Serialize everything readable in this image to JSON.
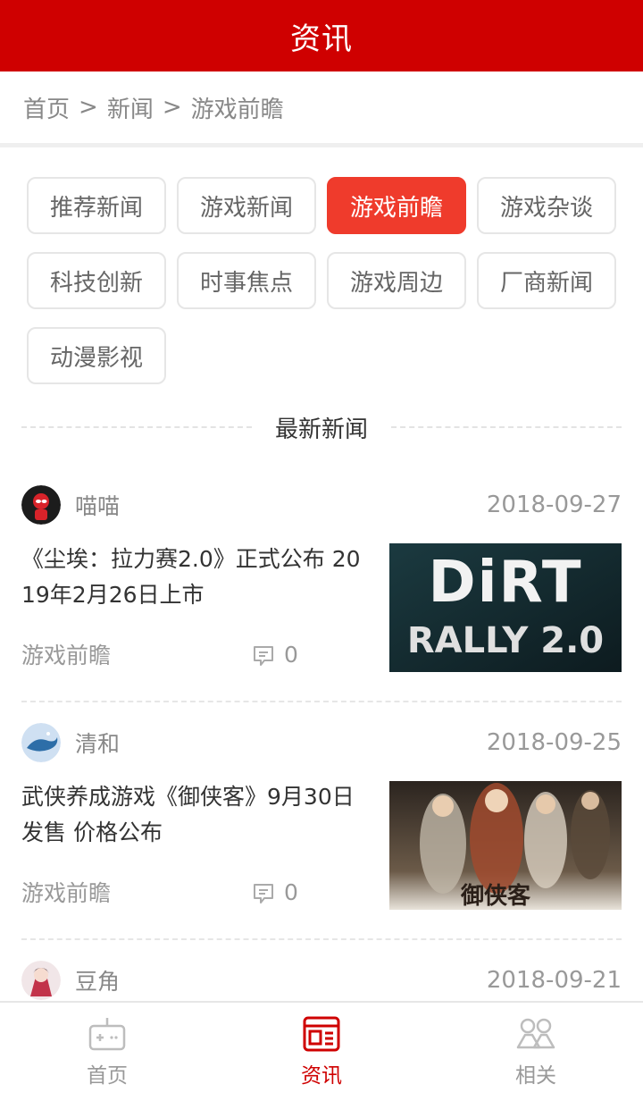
{
  "header": {
    "title": "资讯"
  },
  "breadcrumb": {
    "items": [
      "首页",
      "新闻",
      "游戏前瞻"
    ],
    "separator": ">"
  },
  "categories": [
    {
      "label": "推荐新闻",
      "active": false
    },
    {
      "label": "游戏新闻",
      "active": false
    },
    {
      "label": "游戏前瞻",
      "active": true
    },
    {
      "label": "游戏杂谈",
      "active": false
    },
    {
      "label": "科技创新",
      "active": false
    },
    {
      "label": "时事焦点",
      "active": false
    },
    {
      "label": "游戏周边",
      "active": false
    },
    {
      "label": "厂商新闻",
      "active": false
    },
    {
      "label": "动漫影视",
      "active": false
    }
  ],
  "section": {
    "title": "最新新闻"
  },
  "news": [
    {
      "author": "喵喵",
      "date": "2018-09-27",
      "title": "《尘埃：拉力赛2.0》正式公布 2019年2月26日上市",
      "tag": "游戏前瞻",
      "comments": "0",
      "thumb_text_1": "DiRT",
      "thumb_text_2": "RALLY 2.0"
    },
    {
      "author": "清和",
      "date": "2018-09-25",
      "title": "武侠养成游戏《御侠客》9月30日发售 价格公布",
      "tag": "游戏前瞻",
      "comments": "0",
      "thumb_text_1": "御侠客"
    },
    {
      "author": "豆角",
      "date": "2018-09-21"
    }
  ],
  "tabbar": {
    "items": [
      {
        "label": "首页",
        "icon": "gamepad-icon",
        "active": false
      },
      {
        "label": "资讯",
        "icon": "news-icon",
        "active": true
      },
      {
        "label": "相关",
        "icon": "people-icon",
        "active": false
      }
    ]
  },
  "colors": {
    "primary": "#cf0000",
    "accent": "#ef3b2c"
  }
}
